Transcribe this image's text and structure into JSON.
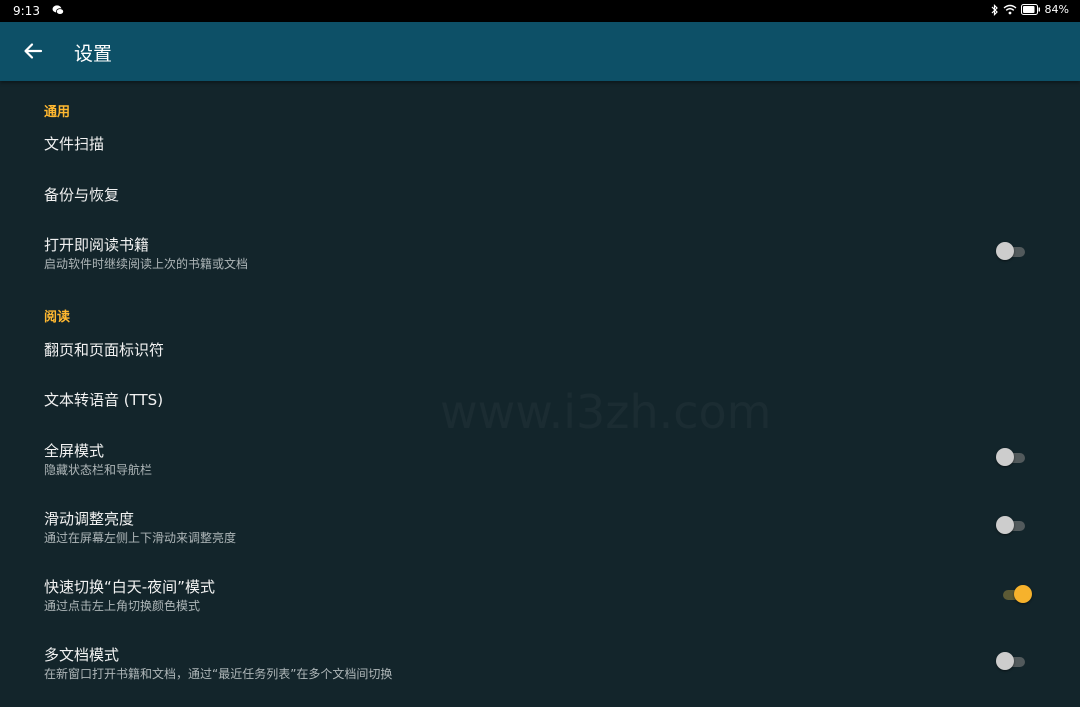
{
  "status_bar": {
    "time": "9:13",
    "battery": "84%"
  },
  "app_bar": {
    "title": "设置"
  },
  "sections": [
    {
      "header": "通用",
      "items": [
        {
          "title": "文件扫描"
        },
        {
          "title": "备份与恢复"
        },
        {
          "title": "打开即阅读书籍",
          "subtitle": "启动软件时继续阅读上次的书籍或文档",
          "toggle": false
        }
      ]
    },
    {
      "header": "阅读",
      "items": [
        {
          "title": "翻页和页面标识符"
        },
        {
          "title": "文本转语音 (TTS)"
        },
        {
          "title": "全屏模式",
          "subtitle": "隐藏状态栏和导航栏",
          "toggle": false
        },
        {
          "title": "滑动调整亮度",
          "subtitle": "通过在屏幕左侧上下滑动来调整亮度",
          "toggle": false
        },
        {
          "title": "快速切换“白天-夜间”模式",
          "subtitle": "通过点击左上角切换颜色模式",
          "toggle": true
        },
        {
          "title": "多文档模式",
          "subtitle": "在新窗口打开书籍和文档，通过“最近任务列表”在多个文档间切换",
          "toggle": false
        }
      ]
    }
  ],
  "watermark": "www.i3zh.com",
  "colors": {
    "background": "#13252b",
    "app_bar": "#0d5067",
    "accent": "#ffb830",
    "toggle_on": "#f6b22c"
  },
  "icons": {
    "back": "arrow-left-icon",
    "bluetooth": "bluetooth-icon",
    "wifi": "wifi-icon",
    "battery": "battery-icon",
    "wechat": "wechat-icon"
  }
}
